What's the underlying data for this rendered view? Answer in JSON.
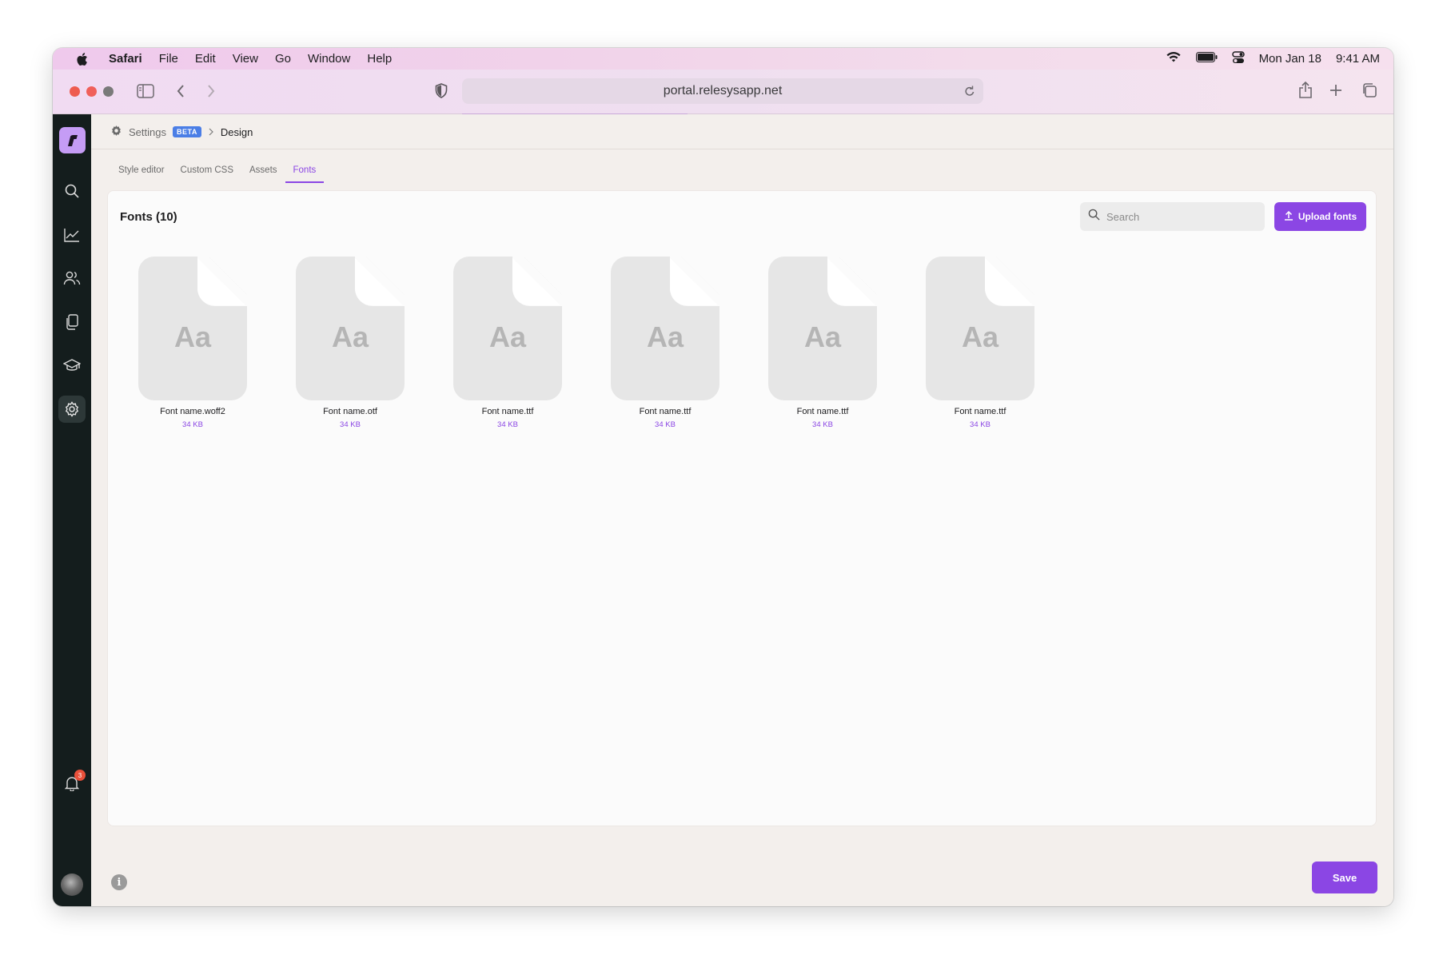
{
  "menubar": {
    "app": "Safari",
    "items": [
      "File",
      "Edit",
      "View",
      "Go",
      "Window",
      "Help"
    ],
    "date": "Mon Jan 18",
    "time": "9:41 AM"
  },
  "browser": {
    "url": "portal.relesysapp.net"
  },
  "breadcrumb": {
    "settings": "Settings",
    "beta": "BETA",
    "current": "Design"
  },
  "tabs": [
    {
      "label": "Style editor",
      "active": false
    },
    {
      "label": "Custom CSS",
      "active": false
    },
    {
      "label": "Assets",
      "active": false
    },
    {
      "label": "Fonts",
      "active": true
    }
  ],
  "panel": {
    "title": "Fonts (10)",
    "search_placeholder": "Search",
    "upload_label": "Upload fonts"
  },
  "fonts": [
    {
      "preview": "Aa",
      "name": "Font name.woff2",
      "size": "34 KB"
    },
    {
      "preview": "Aa",
      "name": "Font name.otf",
      "size": "34 KB"
    },
    {
      "preview": "Aa",
      "name": "Font name.ttf",
      "size": "34 KB"
    },
    {
      "preview": "Aa",
      "name": "Font name.ttf",
      "size": "34 KB"
    },
    {
      "preview": "Aa",
      "name": "Font name.ttf",
      "size": "34 KB"
    },
    {
      "preview": "Aa",
      "name": "Font name.ttf",
      "size": "34 KB"
    }
  ],
  "notifications": {
    "count": "3"
  },
  "footer": {
    "save_label": "Save",
    "info": "i"
  },
  "colors": {
    "accent": "#8b46e4",
    "sidebar": "#141d1d",
    "beta": "#4b7ee6"
  }
}
